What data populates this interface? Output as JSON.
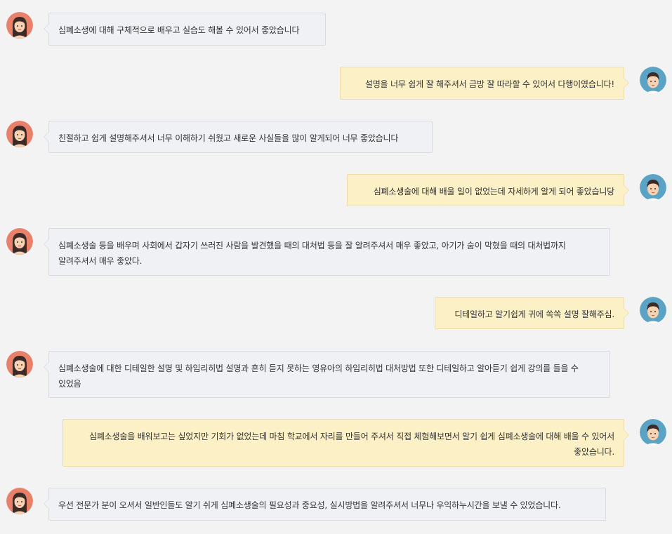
{
  "colors": {
    "background": "#f3f3f4",
    "left_bubble": "#f0f1f5",
    "right_bubble": "#fcf0c6",
    "female_avatar_bg": "#e8806a",
    "male_avatar_bg": "#5ba3c4"
  },
  "messages": [
    {
      "side": "left",
      "avatar": "female-avatar-icon",
      "text": "심폐소생에 대해 구체적으로 배우고 실습도 해볼 수 있어서 좋았습니다"
    },
    {
      "side": "right",
      "avatar": "male-avatar-icon",
      "text": "설명을 너무 쉽게 잘 해주셔서 금방 잘 따라할 수 있어서 다행이였습니다!"
    },
    {
      "side": "left",
      "avatar": "female-avatar-icon",
      "text": "친절하고 쉽게 설명해주셔서 너무 이해하기 쉬웠고 새로운 사실들을 많이 알게되어 너무 좋았습니다"
    },
    {
      "side": "right",
      "avatar": "male-avatar-icon",
      "text": "심폐소생술에 대해 배울 일이 없었는데 자세하게 알게 되어 좋았습니당"
    },
    {
      "side": "left",
      "avatar": "female-avatar-icon",
      "text": "심폐소생술 등을 배우며 사회에서 갑자기 쓰러진 사람을 발견했을 때의 대처법 등을 잘 알려주셔서 매우 좋았고, 아기가 숨이 막혔을 때의 대처법까지 알려주셔서 매우 좋았다."
    },
    {
      "side": "right",
      "avatar": "male-avatar-icon",
      "text": "디테일하고 알기쉽게 귀에 쏙쏙 설명 잘해주심."
    },
    {
      "side": "left",
      "avatar": "female-avatar-icon",
      "text": "심폐소생술에 대한 디테일한 설명 및 하임리히법 설명과 흔히 듣지 못하는 영유아의 하임리히법 대처방법 또한 디테일하고 알아듣기 쉽게 강의를 들을 수 있었음"
    },
    {
      "side": "right",
      "avatar": "male-avatar-icon",
      "text": "심폐소생술을 배워보고는 싶었지만 기회가 없었는데 마침 학교에서 자리를 만들어 주셔서 직접 체험해보면서 알기 쉽게 심폐소생술에 대해 배울 수 있어서 좋았습니다."
    },
    {
      "side": "left",
      "avatar": "female-avatar-icon",
      "text": "우선 전문가 분이 오셔서 일반인들도 알기 쉬게 심폐소생술의 필요성과 중요성, 실시방법을 알려주셔서 너무나 우익하누시간을 보낼 수 있었습니다."
    }
  ]
}
